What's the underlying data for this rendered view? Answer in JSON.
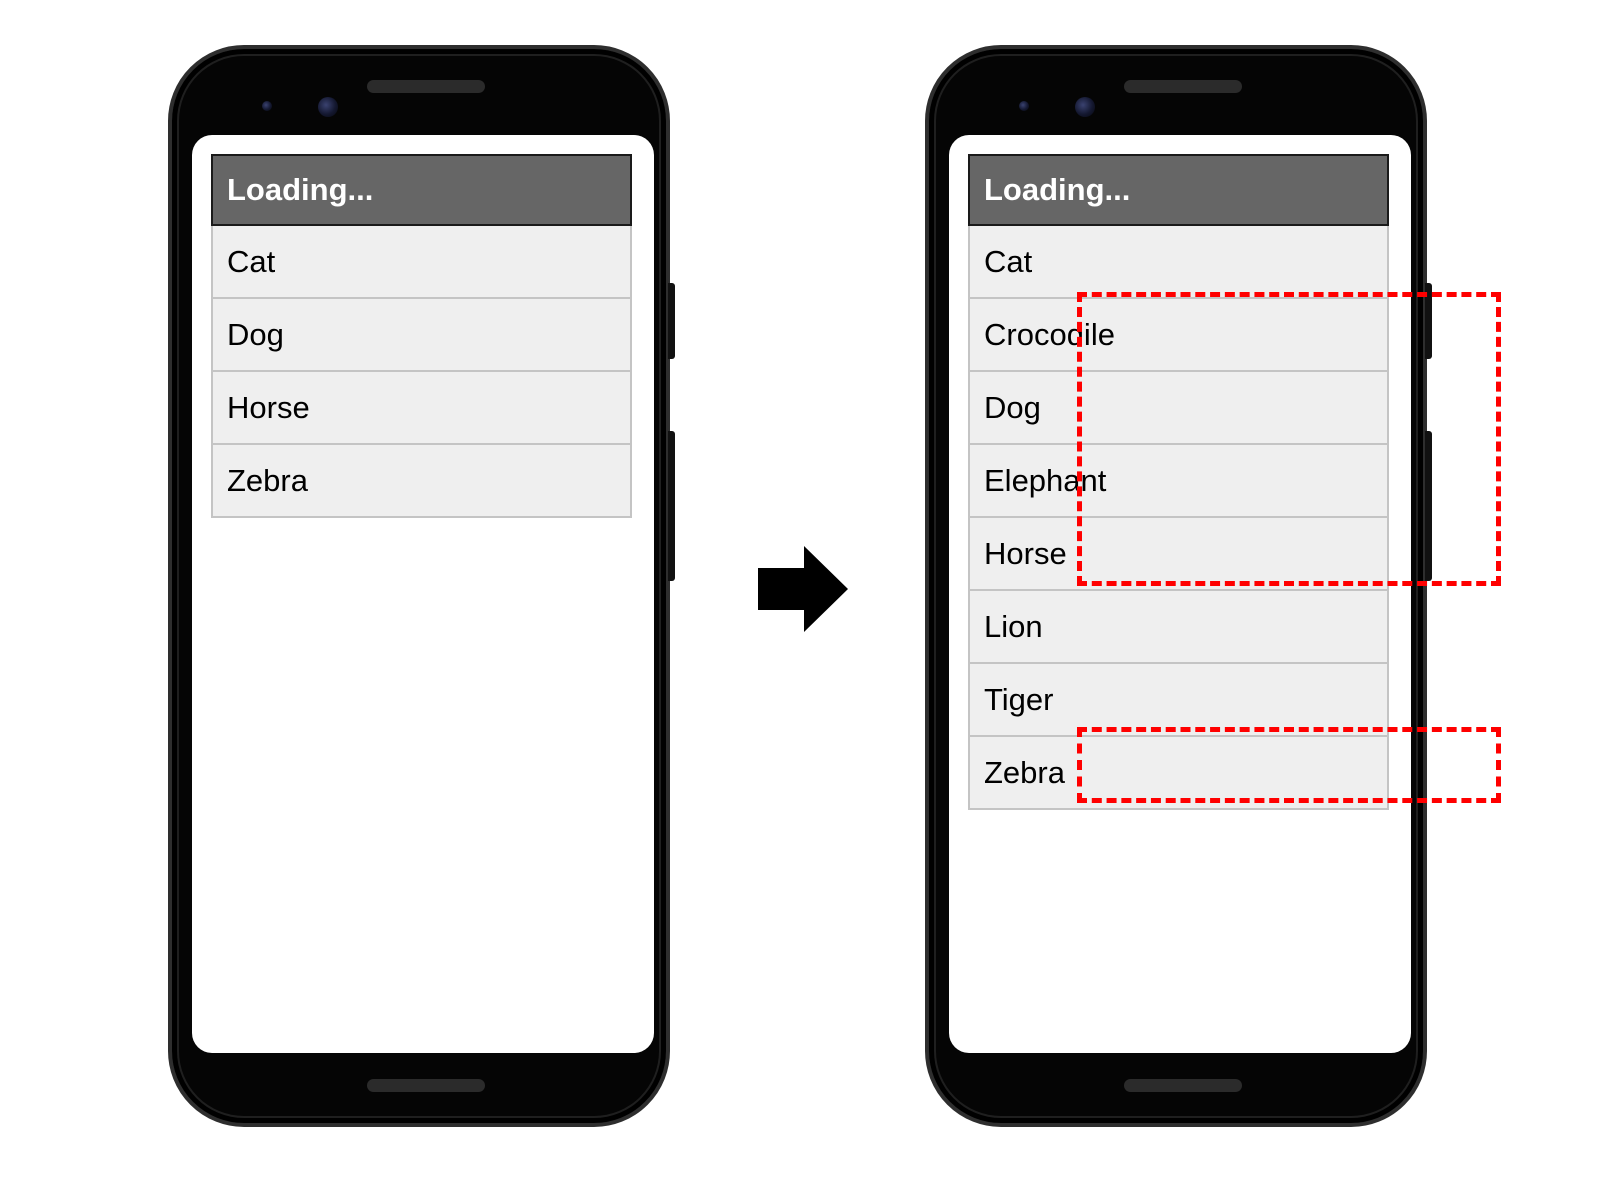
{
  "before": {
    "header": "Loading...",
    "items": [
      "Cat",
      "Dog",
      "Horse",
      "Zebra"
    ]
  },
  "after": {
    "header": "Loading...",
    "items": [
      "Cat",
      "Crocodile",
      "Dog",
      "Elephant",
      "Horse",
      "Lion",
      "Tiger",
      "Zebra"
    ],
    "highlighted_items": [
      "Crocodile",
      "Dog",
      "Elephant",
      "Horse",
      "Zebra"
    ]
  },
  "colors": {
    "highlight": "#ff0000",
    "header_background": "#666666",
    "item_background": "#efefef",
    "phone_body": "#050505"
  },
  "icons": {
    "transition": "right-arrow-icon"
  }
}
